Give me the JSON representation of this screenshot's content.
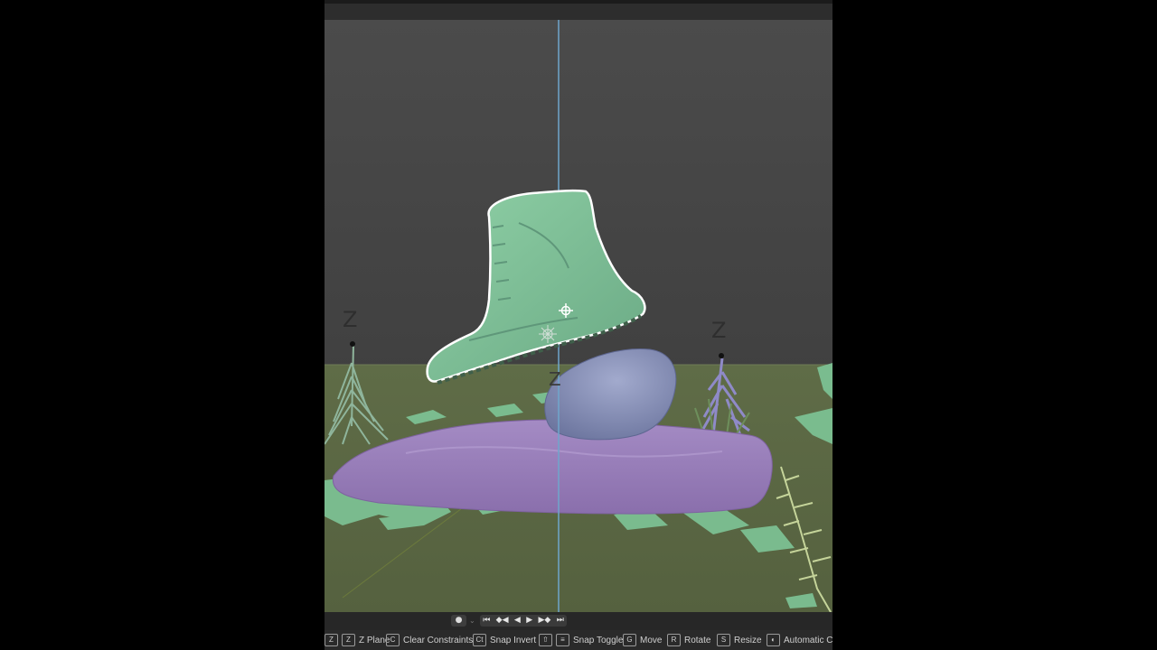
{
  "colors": {
    "background_dark": "#4a4a4a",
    "ground": "#5d6a45",
    "boot_green": "#7dc196",
    "rock_blue": "#8891b8",
    "slab_purple": "#9a7fba",
    "axis_line": "#6fa6cc"
  },
  "viewport": {
    "axis_labels": [
      "Z",
      "Z",
      "Z"
    ]
  },
  "timeline": {
    "record_icon": "record-dot-icon",
    "play_icons": [
      "jump-start-icon",
      "prev-keyframe-icon",
      "play-reverse-icon",
      "play-icon",
      "next-keyframe-icon",
      "jump-end-icon"
    ],
    "play_glyphs": [
      "⏮",
      "◆◀",
      "◀",
      "▶",
      "▶◆",
      "⏭"
    ]
  },
  "statusbar": {
    "items": [
      {
        "keys": [
          "⇧",
          "Z"
        ],
        "label": "Z Plane"
      },
      {
        "keys": [
          "C"
        ],
        "label": "Clear Constraints"
      },
      {
        "keys": [
          "Ctrl"
        ],
        "label": "Snap Invert"
      },
      {
        "keys": [
          "⇧",
          "Tab"
        ],
        "label": "Snap Toggle"
      },
      {
        "keys": [
          "G"
        ],
        "label": "Move"
      },
      {
        "keys": [
          "R"
        ],
        "label": "Rotate"
      },
      {
        "keys": [
          "S"
        ],
        "label": "Resize"
      },
      {
        "keys": [
          "Alt"
        ],
        "label": "Automatic Co"
      }
    ],
    "key_glyphs": [
      "Z",
      "Z",
      "C",
      "Ct",
      "⇧",
      "≡",
      "G",
      "R",
      "S",
      "◐"
    ]
  }
}
